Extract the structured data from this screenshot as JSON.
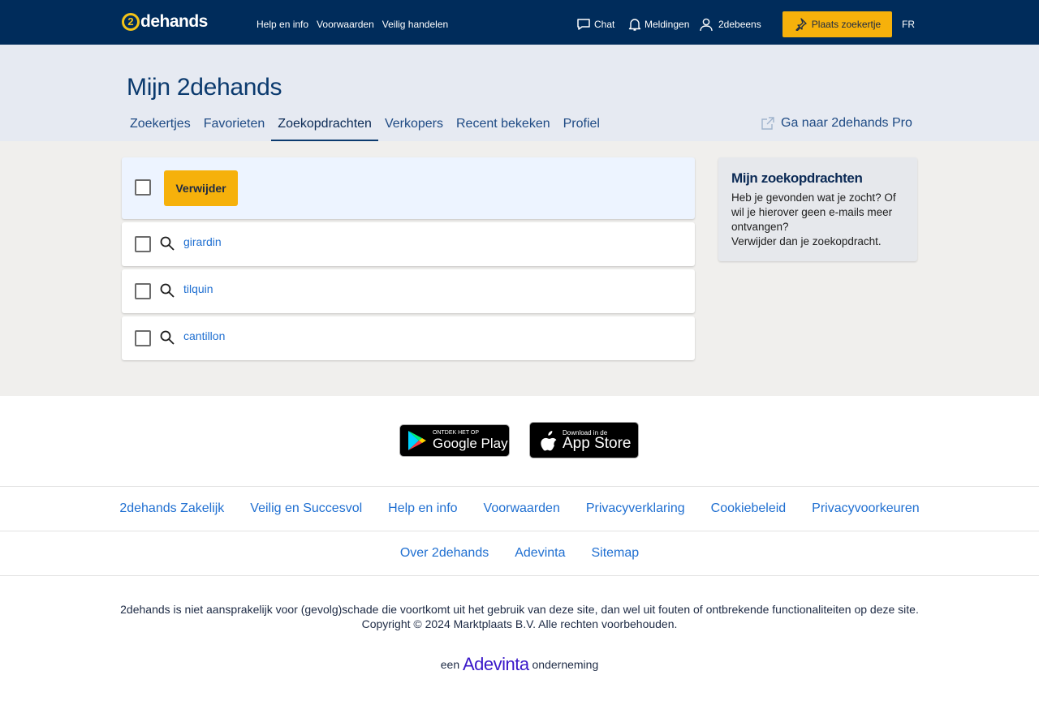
{
  "header": {
    "logo_mark": "2",
    "logo_text": "dehands",
    "nav": [
      "Help en info",
      "Voorwaarden",
      "Veilig handelen"
    ],
    "chat": "Chat",
    "notifications": "Meldingen",
    "user": "2debeens",
    "place_ad": "Plaats zoekertje",
    "language": "FR"
  },
  "subheader": {
    "title": "Mijn 2dehands",
    "tabs": [
      "Zoekertjes",
      "Favorieten",
      "Zoekopdrachten",
      "Verkopers",
      "Recent bekeken",
      "Profiel"
    ],
    "active_tab": "Zoekopdrachten",
    "pro_link": "Ga naar 2dehands Pro"
  },
  "searches": {
    "delete_label": "Verwijder",
    "items": [
      "girardin",
      "tilquin",
      "cantillon"
    ]
  },
  "sidebox": {
    "title": "Mijn zoekopdrachten",
    "text": "Heb je gevonden wat je zocht? Of wil je hierover geen e-mails meer ontvangen?",
    "text2": "Verwijder dan je zoekopdracht."
  },
  "apps": {
    "google_small": "ONTDEK HET OP",
    "google_big": "Google Play",
    "apple_small": "Download in de",
    "apple_big": "App Store"
  },
  "footer": {
    "links_row1": [
      "2dehands Zakelijk",
      "Veilig en Succesvol",
      "Help en info",
      "Voorwaarden",
      "Privacyverklaring",
      "Cookiebeleid",
      "Privacyvoorkeuren"
    ],
    "links_row2": [
      "Over 2dehands",
      "Adevinta",
      "Sitemap"
    ],
    "disclaimer": "2dehands is niet aansprakelijk voor (gevolg)schade die voortkomt uit het gebruik van deze site, dan wel uit fouten of ontbrekende functionaliteiten op deze site.",
    "copyright": "Copyright © 2024 Marktplaats B.V. Alle rechten voorbehouden.",
    "een": "een",
    "adevinta": "Adevinta",
    "onderneming": "onderneming"
  },
  "colors": {
    "topbar": "#002c5b",
    "accent": "#f6b10b",
    "link": "#1f6fd1"
  }
}
